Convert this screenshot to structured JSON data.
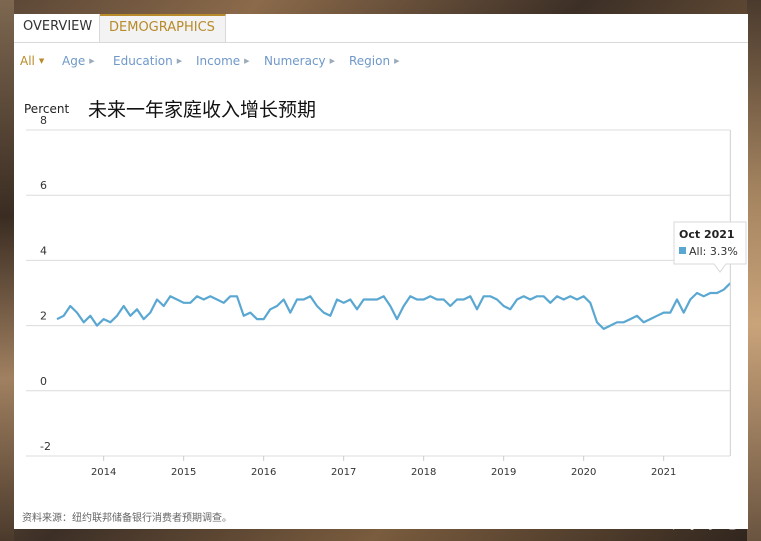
{
  "tabs": [
    {
      "label": "OVERVIEW"
    },
    {
      "label": "DEMOGRAPHICS"
    }
  ],
  "filters": [
    {
      "label": "All"
    },
    {
      "label": "Age"
    },
    {
      "label": "Education"
    },
    {
      "label": "Income"
    },
    {
      "label": "Numeracy"
    },
    {
      "label": "Region"
    }
  ],
  "source_note": "资料来源：纽约联邦储备银行消费者预期调查。",
  "watermark": "汇外网",
  "colors": {
    "series": "#5aa7d2",
    "accent": "#b88a2a",
    "link": "#6f98c9"
  },
  "chart_data": {
    "type": "line",
    "title": "未来一年家庭收入增长预期",
    "ylabel": "Percent",
    "xlabel": "",
    "ylim": [
      -2,
      8
    ],
    "yticks": [
      -2,
      0,
      2,
      4,
      6,
      8
    ],
    "xticks": [
      "2014",
      "2015",
      "2016",
      "2017",
      "2018",
      "2019",
      "2020",
      "2021"
    ],
    "grid": true,
    "series": [
      {
        "name": "All",
        "start": "2013-06",
        "values": [
          2.2,
          2.3,
          2.6,
          2.4,
          2.1,
          2.3,
          2.0,
          2.2,
          2.1,
          2.3,
          2.6,
          2.3,
          2.5,
          2.2,
          2.4,
          2.8,
          2.6,
          2.9,
          2.8,
          2.7,
          2.7,
          2.9,
          2.8,
          2.9,
          2.8,
          2.7,
          2.9,
          2.9,
          2.3,
          2.4,
          2.2,
          2.2,
          2.5,
          2.6,
          2.8,
          2.4,
          2.8,
          2.8,
          2.9,
          2.6,
          2.4,
          2.3,
          2.8,
          2.7,
          2.8,
          2.5,
          2.8,
          2.8,
          2.8,
          2.9,
          2.6,
          2.2,
          2.6,
          2.9,
          2.8,
          2.8,
          2.9,
          2.8,
          2.8,
          2.6,
          2.8,
          2.8,
          2.9,
          2.5,
          2.9,
          2.9,
          2.8,
          2.6,
          2.5,
          2.8,
          2.9,
          2.8,
          2.9,
          2.9,
          2.7,
          2.9,
          2.8,
          2.9,
          2.8,
          2.9,
          2.7,
          2.1,
          1.9,
          2.0,
          2.1,
          2.1,
          2.2,
          2.3,
          2.1,
          2.2,
          2.3,
          2.4,
          2.4,
          2.8,
          2.4,
          2.8,
          3.0,
          2.9,
          3.0,
          3.0,
          3.1,
          3.3
        ]
      }
    ],
    "tooltip": {
      "title": "Oct 2021",
      "text": "All: 3.3%"
    }
  }
}
